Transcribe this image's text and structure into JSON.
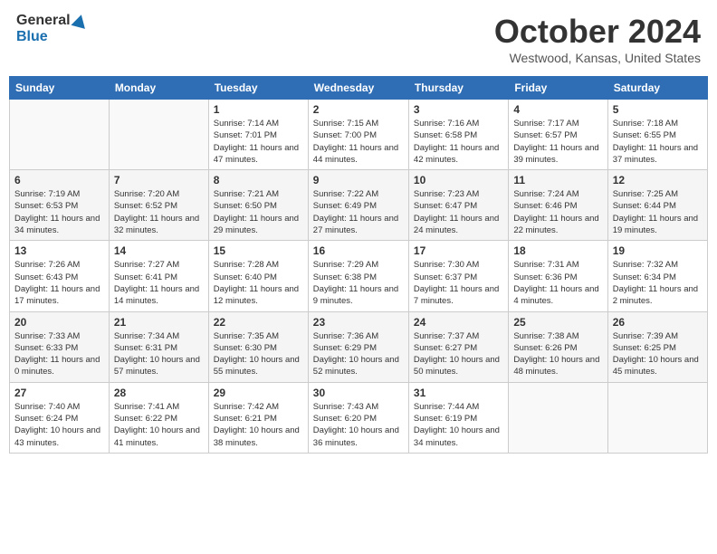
{
  "header": {
    "logo_general": "General",
    "logo_blue": "Blue",
    "title": "October 2024",
    "location": "Westwood, Kansas, United States"
  },
  "calendar": {
    "days_of_week": [
      "Sunday",
      "Monday",
      "Tuesday",
      "Wednesday",
      "Thursday",
      "Friday",
      "Saturday"
    ],
    "weeks": [
      [
        {
          "date": "",
          "sunrise": "",
          "sunset": "",
          "daylight": ""
        },
        {
          "date": "",
          "sunrise": "",
          "sunset": "",
          "daylight": ""
        },
        {
          "date": "1",
          "sunrise": "Sunrise: 7:14 AM",
          "sunset": "Sunset: 7:01 PM",
          "daylight": "Daylight: 11 hours and 47 minutes."
        },
        {
          "date": "2",
          "sunrise": "Sunrise: 7:15 AM",
          "sunset": "Sunset: 7:00 PM",
          "daylight": "Daylight: 11 hours and 44 minutes."
        },
        {
          "date": "3",
          "sunrise": "Sunrise: 7:16 AM",
          "sunset": "Sunset: 6:58 PM",
          "daylight": "Daylight: 11 hours and 42 minutes."
        },
        {
          "date": "4",
          "sunrise": "Sunrise: 7:17 AM",
          "sunset": "Sunset: 6:57 PM",
          "daylight": "Daylight: 11 hours and 39 minutes."
        },
        {
          "date": "5",
          "sunrise": "Sunrise: 7:18 AM",
          "sunset": "Sunset: 6:55 PM",
          "daylight": "Daylight: 11 hours and 37 minutes."
        }
      ],
      [
        {
          "date": "6",
          "sunrise": "Sunrise: 7:19 AM",
          "sunset": "Sunset: 6:53 PM",
          "daylight": "Daylight: 11 hours and 34 minutes."
        },
        {
          "date": "7",
          "sunrise": "Sunrise: 7:20 AM",
          "sunset": "Sunset: 6:52 PM",
          "daylight": "Daylight: 11 hours and 32 minutes."
        },
        {
          "date": "8",
          "sunrise": "Sunrise: 7:21 AM",
          "sunset": "Sunset: 6:50 PM",
          "daylight": "Daylight: 11 hours and 29 minutes."
        },
        {
          "date": "9",
          "sunrise": "Sunrise: 7:22 AM",
          "sunset": "Sunset: 6:49 PM",
          "daylight": "Daylight: 11 hours and 27 minutes."
        },
        {
          "date": "10",
          "sunrise": "Sunrise: 7:23 AM",
          "sunset": "Sunset: 6:47 PM",
          "daylight": "Daylight: 11 hours and 24 minutes."
        },
        {
          "date": "11",
          "sunrise": "Sunrise: 7:24 AM",
          "sunset": "Sunset: 6:46 PM",
          "daylight": "Daylight: 11 hours and 22 minutes."
        },
        {
          "date": "12",
          "sunrise": "Sunrise: 7:25 AM",
          "sunset": "Sunset: 6:44 PM",
          "daylight": "Daylight: 11 hours and 19 minutes."
        }
      ],
      [
        {
          "date": "13",
          "sunrise": "Sunrise: 7:26 AM",
          "sunset": "Sunset: 6:43 PM",
          "daylight": "Daylight: 11 hours and 17 minutes."
        },
        {
          "date": "14",
          "sunrise": "Sunrise: 7:27 AM",
          "sunset": "Sunset: 6:41 PM",
          "daylight": "Daylight: 11 hours and 14 minutes."
        },
        {
          "date": "15",
          "sunrise": "Sunrise: 7:28 AM",
          "sunset": "Sunset: 6:40 PM",
          "daylight": "Daylight: 11 hours and 12 minutes."
        },
        {
          "date": "16",
          "sunrise": "Sunrise: 7:29 AM",
          "sunset": "Sunset: 6:38 PM",
          "daylight": "Daylight: 11 hours and 9 minutes."
        },
        {
          "date": "17",
          "sunrise": "Sunrise: 7:30 AM",
          "sunset": "Sunset: 6:37 PM",
          "daylight": "Daylight: 11 hours and 7 minutes."
        },
        {
          "date": "18",
          "sunrise": "Sunrise: 7:31 AM",
          "sunset": "Sunset: 6:36 PM",
          "daylight": "Daylight: 11 hours and 4 minutes."
        },
        {
          "date": "19",
          "sunrise": "Sunrise: 7:32 AM",
          "sunset": "Sunset: 6:34 PM",
          "daylight": "Daylight: 11 hours and 2 minutes."
        }
      ],
      [
        {
          "date": "20",
          "sunrise": "Sunrise: 7:33 AM",
          "sunset": "Sunset: 6:33 PM",
          "daylight": "Daylight: 11 hours and 0 minutes."
        },
        {
          "date": "21",
          "sunrise": "Sunrise: 7:34 AM",
          "sunset": "Sunset: 6:31 PM",
          "daylight": "Daylight: 10 hours and 57 minutes."
        },
        {
          "date": "22",
          "sunrise": "Sunrise: 7:35 AM",
          "sunset": "Sunset: 6:30 PM",
          "daylight": "Daylight: 10 hours and 55 minutes."
        },
        {
          "date": "23",
          "sunrise": "Sunrise: 7:36 AM",
          "sunset": "Sunset: 6:29 PM",
          "daylight": "Daylight: 10 hours and 52 minutes."
        },
        {
          "date": "24",
          "sunrise": "Sunrise: 7:37 AM",
          "sunset": "Sunset: 6:27 PM",
          "daylight": "Daylight: 10 hours and 50 minutes."
        },
        {
          "date": "25",
          "sunrise": "Sunrise: 7:38 AM",
          "sunset": "Sunset: 6:26 PM",
          "daylight": "Daylight: 10 hours and 48 minutes."
        },
        {
          "date": "26",
          "sunrise": "Sunrise: 7:39 AM",
          "sunset": "Sunset: 6:25 PM",
          "daylight": "Daylight: 10 hours and 45 minutes."
        }
      ],
      [
        {
          "date": "27",
          "sunrise": "Sunrise: 7:40 AM",
          "sunset": "Sunset: 6:24 PM",
          "daylight": "Daylight: 10 hours and 43 minutes."
        },
        {
          "date": "28",
          "sunrise": "Sunrise: 7:41 AM",
          "sunset": "Sunset: 6:22 PM",
          "daylight": "Daylight: 10 hours and 41 minutes."
        },
        {
          "date": "29",
          "sunrise": "Sunrise: 7:42 AM",
          "sunset": "Sunset: 6:21 PM",
          "daylight": "Daylight: 10 hours and 38 minutes."
        },
        {
          "date": "30",
          "sunrise": "Sunrise: 7:43 AM",
          "sunset": "Sunset: 6:20 PM",
          "daylight": "Daylight: 10 hours and 36 minutes."
        },
        {
          "date": "31",
          "sunrise": "Sunrise: 7:44 AM",
          "sunset": "Sunset: 6:19 PM",
          "daylight": "Daylight: 10 hours and 34 minutes."
        },
        {
          "date": "",
          "sunrise": "",
          "sunset": "",
          "daylight": ""
        },
        {
          "date": "",
          "sunrise": "",
          "sunset": "",
          "daylight": ""
        }
      ]
    ]
  }
}
